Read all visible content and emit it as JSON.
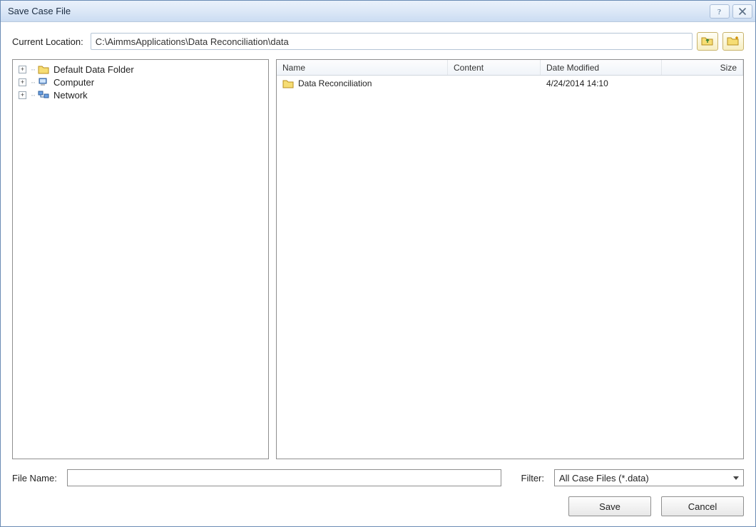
{
  "window": {
    "title": "Save Case File"
  },
  "location": {
    "label": "Current Location:",
    "value": "C:\\AimmsApplications\\Data Reconciliation\\data"
  },
  "tree": {
    "nodes": [
      {
        "icon": "folder",
        "label": "Default Data Folder"
      },
      {
        "icon": "computer",
        "label": "Computer"
      },
      {
        "icon": "network",
        "label": "Network"
      }
    ]
  },
  "list": {
    "headers": {
      "name": "Name",
      "content": "Content",
      "date": "Date Modified",
      "size": "Size"
    },
    "rows": [
      {
        "icon": "folder",
        "name": "Data Reconciliation",
        "content": "",
        "date": "4/24/2014 14:10",
        "size": ""
      }
    ]
  },
  "filename": {
    "label": "File Name:",
    "value": ""
  },
  "filter": {
    "label": "Filter:",
    "value": "All Case Files (*.data)"
  },
  "buttons": {
    "save": "Save",
    "cancel": "Cancel"
  },
  "icons": {
    "help": "help-icon",
    "close": "close-icon",
    "folder_up": "folder-up-icon",
    "new_folder": "new-folder-icon"
  }
}
